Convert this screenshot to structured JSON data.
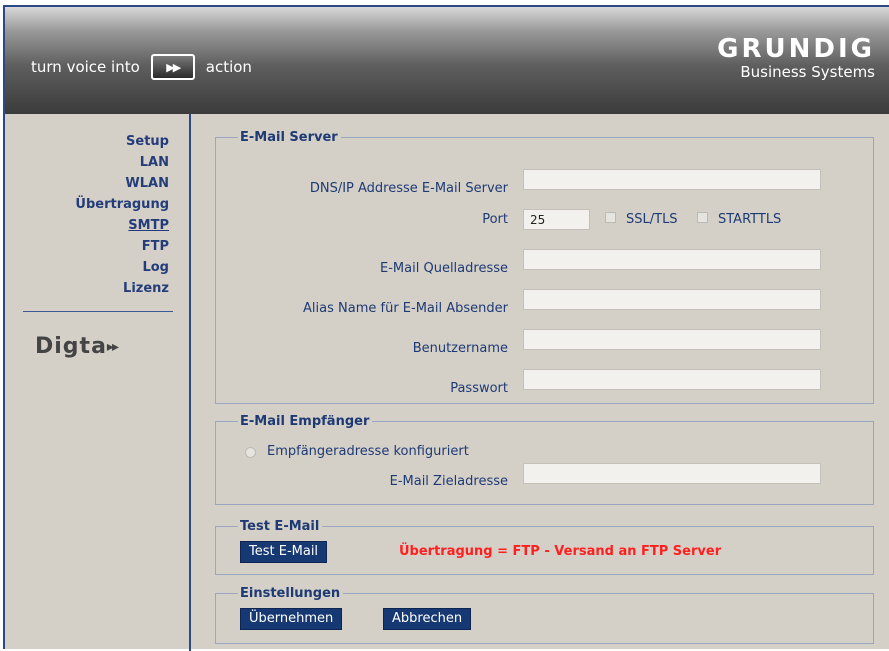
{
  "header": {
    "slogan_before": "turn voice into",
    "slogan_after": "action",
    "brand_name": "GRUNDIG",
    "brand_sub": "Business Systems"
  },
  "sidebar": {
    "items": [
      {
        "label": "Setup"
      },
      {
        "label": "LAN"
      },
      {
        "label": "WLAN"
      },
      {
        "label": "Übertragung"
      },
      {
        "label": "SMTP",
        "active": true
      },
      {
        "label": "FTP"
      },
      {
        "label": "Log"
      },
      {
        "label": "Lizenz"
      }
    ],
    "logo_text": "Digta"
  },
  "email_server": {
    "legend": "E-Mail Server",
    "dns_label": "DNS/IP Addresse E-Mail Server",
    "dns_value": "",
    "port_label": "Port",
    "port_value": "25",
    "ssl_label": "SSL/TLS",
    "starttls_label": "STARTTLS",
    "source_label": "E-Mail Quelladresse",
    "source_value": "",
    "alias_label": "Alias Name für E-Mail Absender",
    "alias_value": "",
    "user_label": "Benutzername",
    "user_value": "",
    "password_label": "Passwort",
    "password_value": ""
  },
  "recipient": {
    "legend": "E-Mail Empfänger",
    "radio_label": "Empfängeradresse konfiguriert",
    "target_label": "E-Mail Zieladresse",
    "target_value": ""
  },
  "test": {
    "legend": "Test E-Mail",
    "button_label": "Test E-Mail",
    "status_message": "Übertragung = FTP - Versand an FTP Server"
  },
  "settings": {
    "legend": "Einstellungen",
    "apply_label": "Übernehmen",
    "cancel_label": "Abbrechen"
  },
  "colors": {
    "nav_text": "#243d7a",
    "button_bg": "#163973",
    "status_red": "#ff1f1f",
    "panel_bg": "#d4d0c8"
  }
}
